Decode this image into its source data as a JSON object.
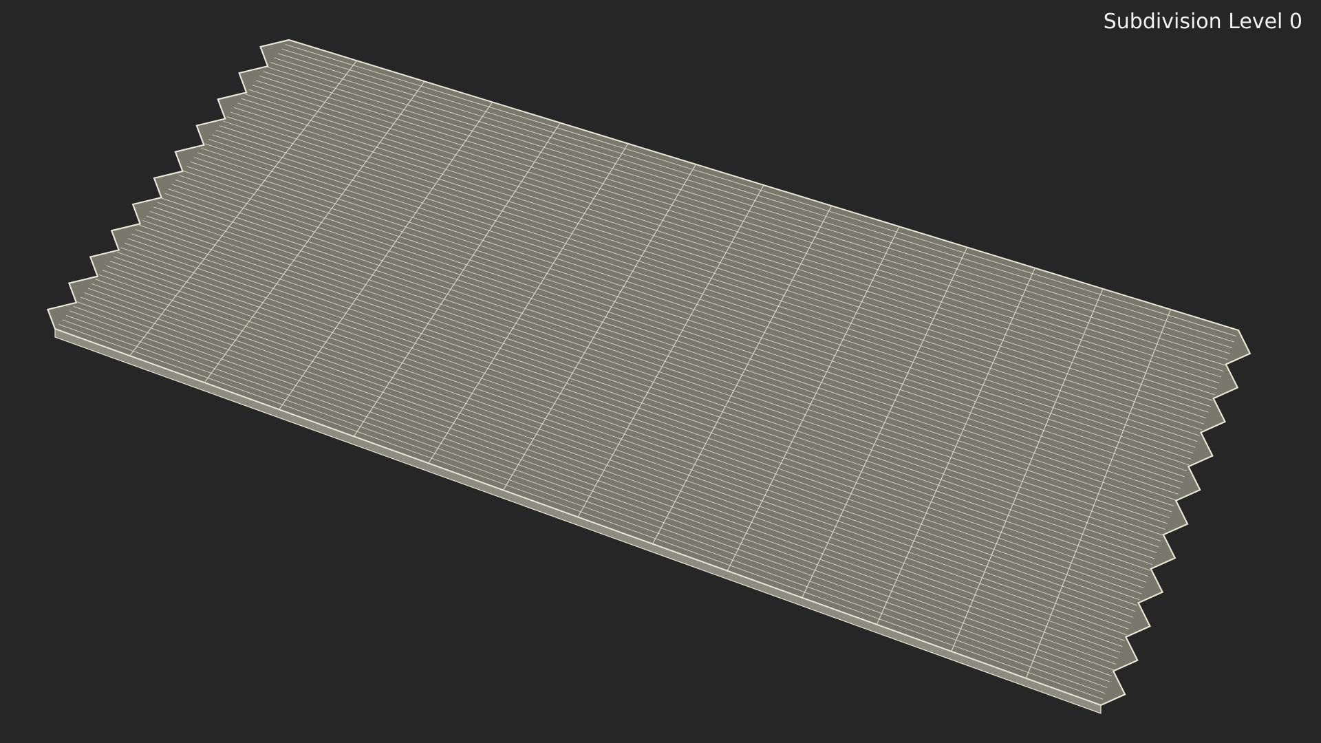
{
  "viewport": {
    "subdivision_label": "Subdivision Level 0"
  },
  "colors": {
    "background": "#262626",
    "surface": "#78786d",
    "wire": "#e8e8d8",
    "side": "#8c8c80",
    "label": "#f2f2f2"
  }
}
